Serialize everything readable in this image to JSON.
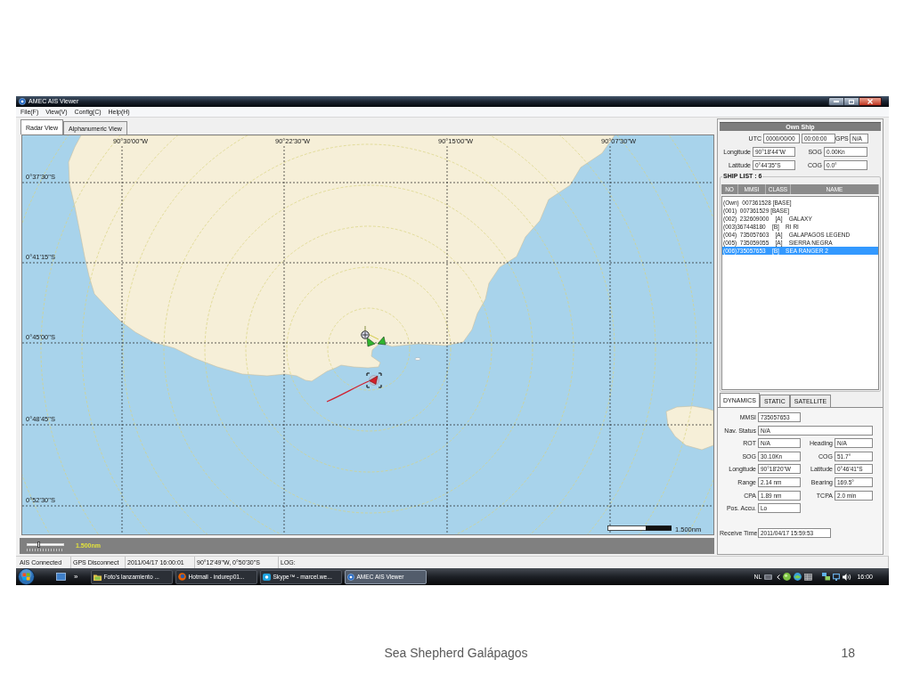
{
  "window": {
    "title": "AMEC AIS Viewer"
  },
  "menu": [
    "File(F)",
    "View(V)",
    "Config(C)",
    "Help(H)"
  ],
  "view_tabs": [
    {
      "label": "Radar View",
      "selected": true
    },
    {
      "label": "Alphanumeric View",
      "selected": false
    }
  ],
  "map": {
    "longitude_labels": [
      "90°30'00\"W",
      "90°22'30\"W",
      "90°15'00\"W",
      "90°07'30\"W"
    ],
    "latitude_labels": [
      "0°37'30\"S",
      "0°41'15\"S",
      "0°45'00\"S",
      "0°48'45\"S",
      "0°52'30\"S"
    ],
    "scale_label": "1.500nm"
  },
  "zoom_bar": {
    "level": 0.3,
    "label": "1.500nm"
  },
  "own_ship": {
    "title": "Own Ship",
    "rows": [
      [
        {
          "label": "UTC",
          "values": [
            "0000/00/00",
            "00:00:00"
          ]
        },
        {
          "label": "GPS",
          "values": [
            "N/A"
          ]
        }
      ],
      [
        {
          "label": "Longitude",
          "values": [
            "90°18'44\"W"
          ]
        },
        {
          "label": "SOG",
          "values": [
            "0.00Kn"
          ]
        }
      ],
      [
        {
          "label": "Latitude",
          "values": [
            "0°44'35\"S"
          ]
        },
        {
          "label": "COG",
          "values": [
            "0.0°"
          ]
        }
      ]
    ]
  },
  "ship_list": {
    "title": "SHIP LIST : 6",
    "columns": [
      "NO",
      "MMSI",
      "CLASS",
      "NAME"
    ],
    "rows": [
      {
        "text": "(Own)  007361528 [BASE]",
        "selected": false
      },
      {
        "text": "(001)  007361529 [BASE]",
        "selected": false
      },
      {
        "text": "(002)  232609000    [A]    GALAXY",
        "selected": false
      },
      {
        "text": "(003)367448180    [B]    RI RI",
        "selected": false
      },
      {
        "text": "(004)  735057603    [A]    GALAPAGOS LEGEND",
        "selected": false
      },
      {
        "text": "(005)  735059055    [A]    SIERRA NEGRA",
        "selected": false
      },
      {
        "text": "(006)735057653    [B]    SEA RANGER 2",
        "selected": true
      }
    ]
  },
  "detail_tabs": [
    {
      "label": "DYNAMICS",
      "selected": true
    },
    {
      "label": "STATIC",
      "selected": false
    },
    {
      "label": "SATELLITE",
      "selected": false
    }
  ],
  "details": {
    "rows": [
      [
        {
          "label": "MMSI",
          "value": "735057653"
        }
      ],
      [
        {
          "label": "Nav. Status",
          "value": "N/A"
        }
      ],
      [
        {
          "label": "ROT",
          "value": "N/A"
        },
        {
          "label": "Heading",
          "value": "N/A"
        }
      ],
      [
        {
          "label": "SOG",
          "value": "30.10Kn"
        },
        {
          "label": "COG",
          "value": "51.7°"
        }
      ],
      [
        {
          "label": "Longitude",
          "value": "90°18'20\"W"
        },
        {
          "label": "Latitude",
          "value": "0°46'41\"S"
        }
      ],
      [
        {
          "label": "Range",
          "value": "2.14 nm"
        },
        {
          "label": "Bearing",
          "value": "169.5°"
        }
      ],
      [
        {
          "label": "CPA",
          "value": "1.89 nm"
        },
        {
          "label": "TCPA",
          "value": "2.0 min"
        }
      ],
      [
        {
          "label": "Pos. Accu.",
          "value": "Lo"
        }
      ]
    ],
    "receive_time": {
      "label": "Receive Time",
      "value": "2011/04/17 15:59:53"
    }
  },
  "status_bar": [
    "AIS Connected",
    "GPS Disconnect",
    "2011/04/17 16:00:01",
    "90°12'49\"W, 0°50'30\"S",
    "LOG:"
  ],
  "taskbar": {
    "overflow": "»",
    "buttons": [
      {
        "label": "Foto's lanzamiento ...",
        "kind": "folder",
        "selected": false
      },
      {
        "label": "Hotmail - indurep01...",
        "kind": "browser",
        "selected": false
      },
      {
        "label": "Skype™ - marcel.we...",
        "kind": "messenger",
        "selected": false
      },
      {
        "label": "AMEC AIS Viewer",
        "kind": "app",
        "selected": true
      }
    ],
    "language": "NL",
    "clock": "16:00"
  },
  "footer": {
    "text": "Sea Shepherd Galápagos",
    "page": "18"
  }
}
